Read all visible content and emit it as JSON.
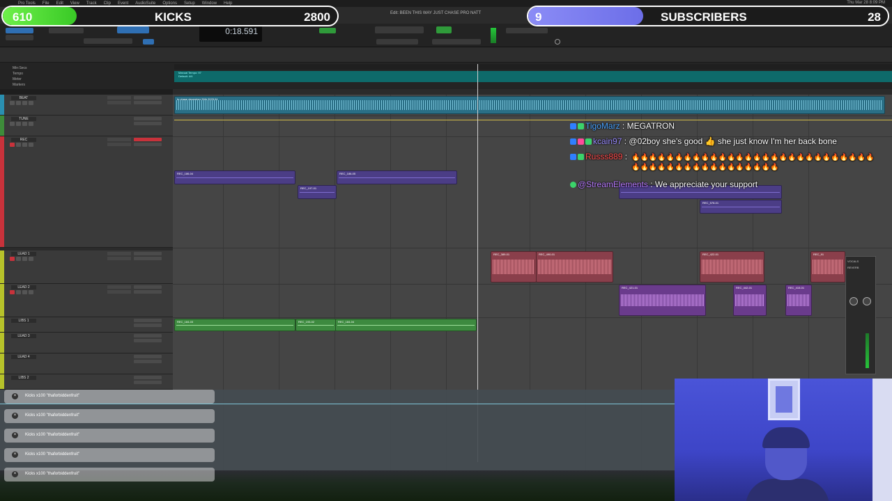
{
  "menubar": {
    "app": "Pro Tools",
    "items": [
      "File",
      "Edit",
      "View",
      "Track",
      "Clip",
      "Event",
      "AudioSuite",
      "Options",
      "Setup",
      "Window",
      "Help"
    ],
    "datetime": "Thu Mar 28 8:09 PM"
  },
  "overlay": {
    "kicks_goal": {
      "current": "610",
      "label": "KICKS",
      "target": "2800",
      "progress": 0.22
    },
    "subs_goal": {
      "current": "9",
      "label": "SUBSCRIBERS",
      "target": "28",
      "progress": 0.32
    }
  },
  "session": {
    "edit_title": "Edit: BEEN THIS WAY JUST CHASE PRO NATT",
    "counter": "0:18.591"
  },
  "tracks": [
    {
      "name": "BEAT",
      "color": "#2a8fb0"
    },
    {
      "name": "TUNE",
      "color": "#3e8c3a"
    },
    {
      "name": "REC",
      "color": "#c8323b"
    },
    {
      "name": "LEAD 1",
      "color": "#b6c22a"
    },
    {
      "name": "LEAD 2",
      "color": "#b6c22a"
    },
    {
      "name": "LIBS 1",
      "color": "#b6c22a"
    },
    {
      "name": "LEAD 3",
      "color": "#b6c22a"
    },
    {
      "name": "LEAD 4",
      "color": "#b6c22a"
    },
    {
      "name": "LIBS 2",
      "color": "#b6c22a"
    }
  ],
  "clips": {
    "beat": "fo chase december 26th 2025.04",
    "rec": [
      "REC_186-04",
      "REC_197-01",
      "REC_186-05"
    ],
    "rec_right": [
      "REC_578-01"
    ],
    "lead1": [
      "REC_389-01",
      "REC_490-01",
      "REC_422-01",
      "REC_91"
    ],
    "lead2": [
      "REC_421-01",
      "REC_442-01",
      "REC_415-01"
    ],
    "libs1": [
      "REC_184-03",
      "REC_193-02",
      "REC_184-04"
    ]
  },
  "chat": [
    {
      "user": "TigoMarz",
      "message": ": MEGATRON"
    },
    {
      "user": "kcain97",
      "message": ": @02boy she's good 👍 she just know I'm her back bone"
    },
    {
      "user": "Russs889",
      "message": ": "
    },
    {
      "user": "@StreamElements",
      "message": ": We appreciate your support"
    }
  ],
  "fire_emojis": "🔥🔥🔥🔥🔥🔥🔥🔥🔥🔥🔥🔥🔥🔥🔥🔥🔥🔥🔥🔥🔥🔥🔥🔥🔥🔥🔥🔥🔥🔥🔥🔥🔥🔥🔥🔥🔥🔥🔥🔥🔥🔥🔥🔥🔥",
  "toasts": [
    "Kicks x100 \"thaforbiddenfruit\"",
    "Kicks x100 \"thaforbiddenfruit\"",
    "Kicks x100 \"thaforbiddenfruit\"",
    "Kicks x100 \"thaforbiddenfruit\"",
    "Kicks x100 \"thaforbiddenfruit\""
  ],
  "plugin": {
    "title": "VOCALS",
    "insert": "REVERB"
  }
}
